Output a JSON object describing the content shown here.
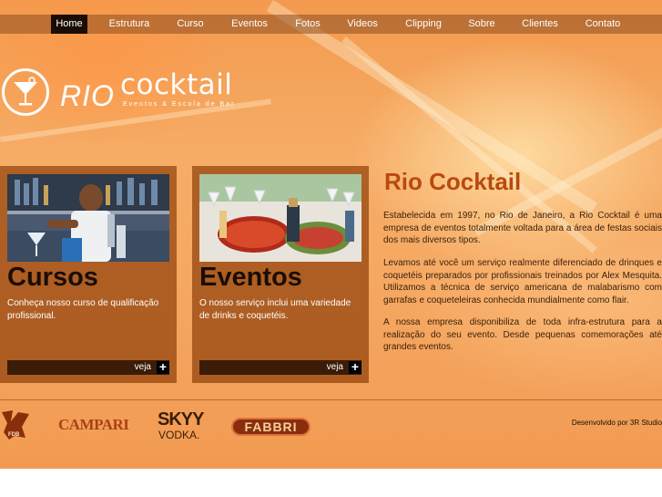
{
  "nav": {
    "items": [
      {
        "label": "Home",
        "active": true
      },
      {
        "label": "Estrutura",
        "active": false
      },
      {
        "label": "Curso",
        "active": false
      },
      {
        "label": "Eventos",
        "active": false
      },
      {
        "label": "Fotos",
        "active": false
      },
      {
        "label": "Videos",
        "active": false
      },
      {
        "label": "Clipping",
        "active": false
      },
      {
        "label": "Sobre",
        "active": false
      },
      {
        "label": "Clientes",
        "active": false
      },
      {
        "label": "Contato",
        "active": false
      }
    ]
  },
  "logo": {
    "rio": "RIO",
    "cocktail": "cocktail",
    "tagline": "Eventos & Escola de Bar",
    "icon": "martini-glass-icon"
  },
  "cards": [
    {
      "title": "Cursos",
      "description": "Conheça nosso curso de qualificação profissional.",
      "more_label": "veja",
      "photo": "bartender-photo"
    },
    {
      "title": "Eventos",
      "description": "O nosso serviço inclui uma variedade de drinks e coquetéis.",
      "more_label": "veja",
      "photo": "buffet-table-photo"
    }
  ],
  "intro": {
    "title": "Rio Cocktail",
    "paragraphs": [
      "Estabelecida em 1997, no Rio de Janeiro, a Rio Cocktail é uma empresa de eventos totalmente voltada para a área de festas sociais dos mais diversos tipos.",
      "Levamos até você um serviço realmente diferenciado de drinques e coquetéis preparados por profissionais treinados por Alex Mesquita. Utilizamos a técnica de serviço americana de malabarismo com garrafas e coqueteleiras conhecida mundialmente como flair.",
      "A nossa empresa disponibiliza de toda infra-estrutura para a realização do seu evento. Desde pequenas comemorações até grandes eventos."
    ]
  },
  "footer": {
    "brands": [
      "FDB",
      "CAMPARI",
      "SKYY",
      "VODKA.",
      "FABBRI"
    ],
    "credit": "Desenvolvido por 3R Studio"
  },
  "colors": {
    "accent": "#b84a0f",
    "nav_active": "#1a0d05",
    "card_bg": "#96460f"
  }
}
